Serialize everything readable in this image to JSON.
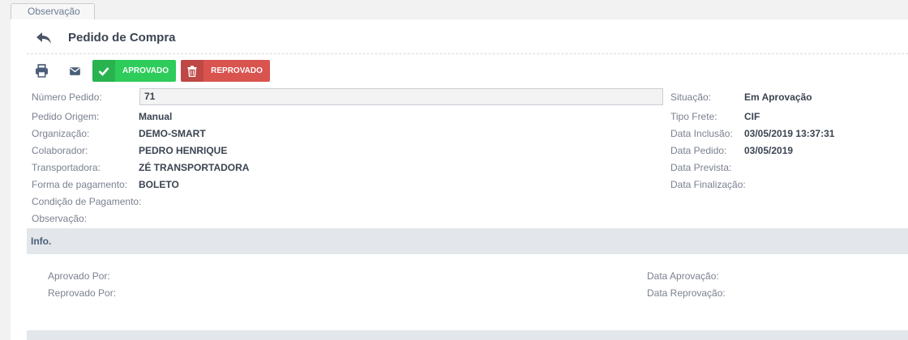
{
  "tab": {
    "label": "Observação"
  },
  "header": {
    "title": "Pedido de Compra"
  },
  "toolbar": {
    "approve_label": "APROVADO",
    "reject_label": "REPROVADO",
    "approve_color": "#2ecc5b",
    "reject_color": "#d9534f"
  },
  "form": {
    "numero_pedido": {
      "label": "Número Pedido:",
      "value": "71"
    },
    "pedido_origem": {
      "label": "Pedido Origem:",
      "value": "Manual"
    },
    "organizacao": {
      "label": "Organização:",
      "value": "DEMO-SMART"
    },
    "colaborador": {
      "label": "Colaborador:",
      "value": "PEDRO HENRIQUE"
    },
    "transportadora": {
      "label": "Transportadora:",
      "value": "ZÉ TRANSPORTADORA"
    },
    "forma_pagamento": {
      "label": "Forma de pagamento:",
      "value": "BOLETO"
    },
    "condicao_pagamento": {
      "label": "Condição de Pagamento:",
      "value": ""
    },
    "observacao": {
      "label": "Observação:",
      "value": ""
    },
    "situacao": {
      "label": "Situação:",
      "value": "Em Aprovação"
    },
    "tipo_frete": {
      "label": "Tipo Frete:",
      "value": "CIF"
    },
    "data_inclusao": {
      "label": "Data Inclusão:",
      "value": "03/05/2019 13:37:31"
    },
    "data_pedido": {
      "label": "Data Pedido:",
      "value": "03/05/2019"
    },
    "data_prevista": {
      "label": "Data Prevista:",
      "value": ""
    },
    "data_finalizacao": {
      "label": "Data Finalização:",
      "value": ""
    }
  },
  "info": {
    "title": "Info.",
    "aprovado_por": {
      "label": "Aprovado Por:",
      "value": ""
    },
    "reprovado_por": {
      "label": "Reprovado Por:",
      "value": ""
    },
    "data_aprovacao": {
      "label": "Data Aprovação:",
      "value": ""
    },
    "data_reprovacao": {
      "label": "Data Reprovação:",
      "value": ""
    }
  },
  "icons": {
    "back": "undo-arrow-icon",
    "print": "printer-icon",
    "mail": "envelope-icon",
    "approve": "check-icon",
    "reject": "trash-icon"
  }
}
